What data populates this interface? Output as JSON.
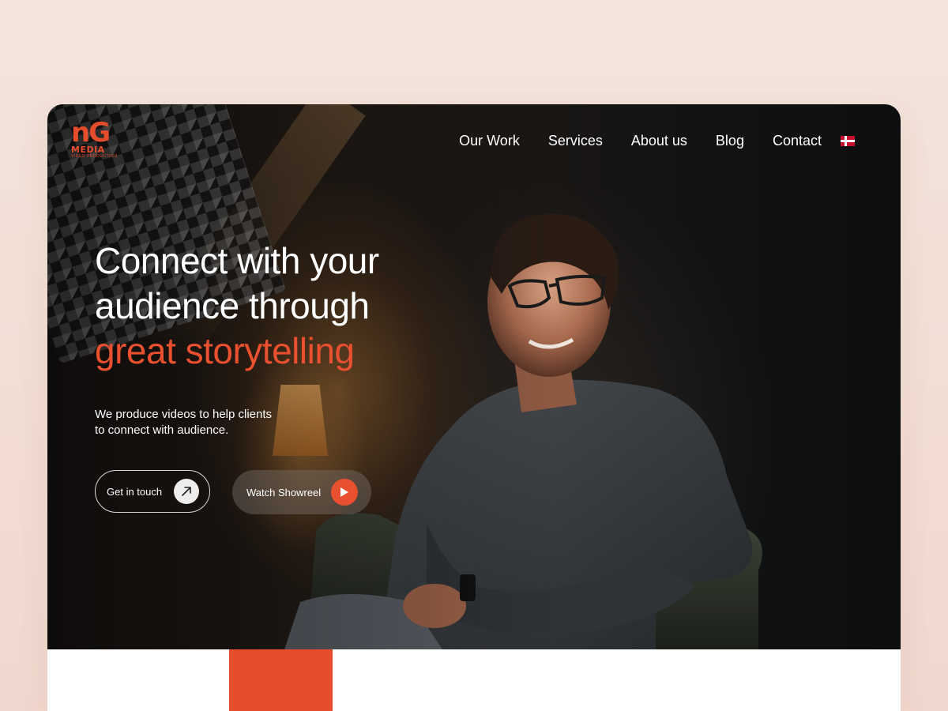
{
  "brand": {
    "logo_mark": "nG",
    "logo_word": "MEDIA",
    "logo_tag": "VIDEO PRODUCTION",
    "accent_color": "#e8502f"
  },
  "nav": {
    "items": [
      "Our Work",
      "Services",
      "About us",
      "Blog",
      "Contact"
    ],
    "language_flag": "danish-flag-icon"
  },
  "hero": {
    "headline_line1": "Connect with your",
    "headline_line2": "audience through",
    "headline_accent": "great storytelling",
    "subtext_line1": "We produce videos to help clients",
    "subtext_line2": "to connect with audience.",
    "cta_primary": "Get in touch",
    "cta_primary_icon": "arrow-up-right-icon",
    "cta_secondary": "Watch Showreel",
    "cta_secondary_icon": "play-icon"
  }
}
